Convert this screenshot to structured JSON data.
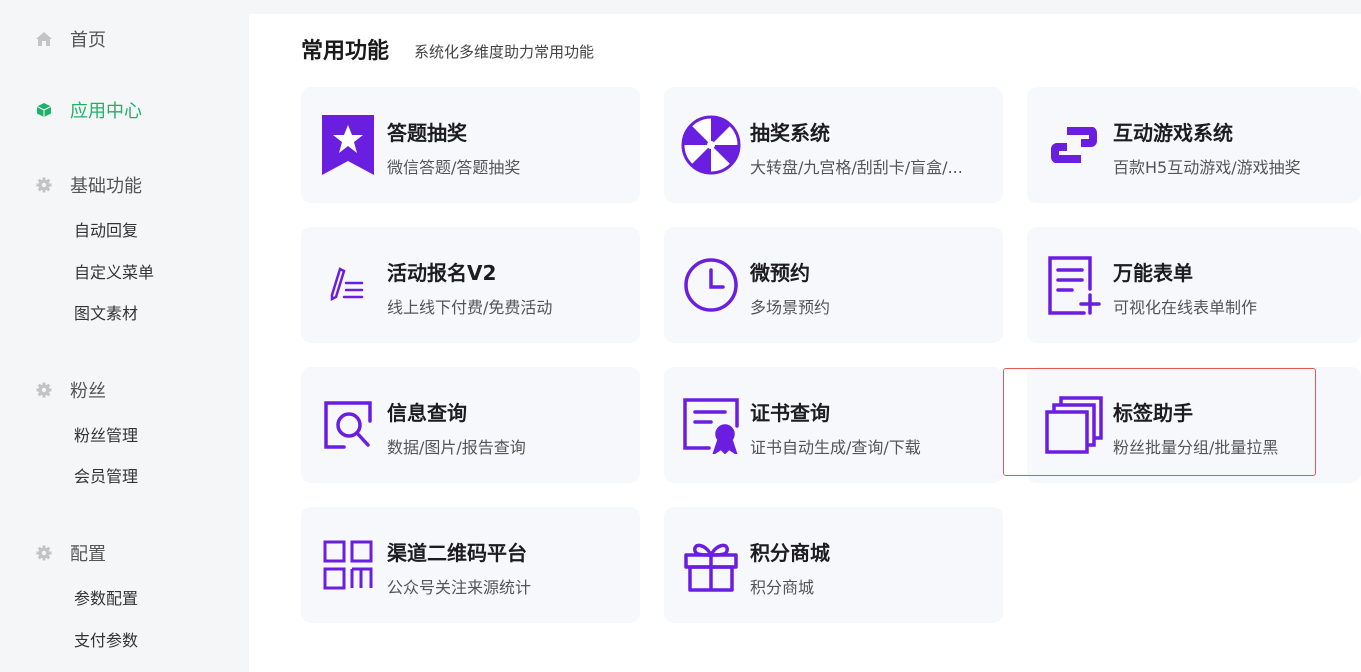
{
  "sidebar": {
    "home": {
      "label": "首页",
      "icon": "home-icon"
    },
    "app_center": {
      "label": "应用中心",
      "icon": "cube-icon",
      "color": "#1fb16a"
    },
    "basic": {
      "label": "基础功能",
      "icon": "gear-icon",
      "items": [
        "自动回复",
        "自定义菜单",
        "图文素材"
      ]
    },
    "fans": {
      "label": "粉丝",
      "icon": "gear-icon",
      "items": [
        "粉丝管理",
        "会员管理"
      ]
    },
    "config": {
      "label": "配置",
      "icon": "gear-icon",
      "items": [
        "参数配置",
        "支付参数"
      ]
    }
  },
  "main": {
    "section_title": "常用功能",
    "section_subtitle": "系统化多维度助力常用功能",
    "accent_color": "#6a1fe0",
    "cards": [
      {
        "title": "答题抽奖",
        "desc": "微信答题/答题抽奖",
        "icon": "star-badge-icon"
      },
      {
        "title": "抽奖系统",
        "desc": "大转盘/九宫格/刮刮卡/盲盒/...",
        "icon": "wheel-icon"
      },
      {
        "title": "互动游戏系统",
        "desc": "百款H5互动游戏/游戏抽奖",
        "icon": "link-blocks-icon"
      },
      {
        "title": "活动报名V2",
        "desc": "线上线下付费/免费活动",
        "icon": "pen-list-icon"
      },
      {
        "title": "微预约",
        "desc": "多场景预约",
        "icon": "clock-icon"
      },
      {
        "title": "万能表单",
        "desc": "可视化在线表单制作",
        "icon": "form-add-icon"
      },
      {
        "title": "信息查询",
        "desc": "数据/图片/报告查询",
        "icon": "search-doc-icon"
      },
      {
        "title": "证书查询",
        "desc": "证书自动生成/查询/下载",
        "icon": "certificate-icon"
      },
      {
        "title": "标签助手",
        "desc": "粉丝批量分组/批量拉黑",
        "icon": "stack-icon"
      },
      {
        "title": "渠道二维码平台",
        "desc": "公众号关注来源统计",
        "icon": "qr-grid-icon"
      },
      {
        "title": "积分商城",
        "desc": "积分商城",
        "icon": "gift-icon"
      }
    ]
  }
}
